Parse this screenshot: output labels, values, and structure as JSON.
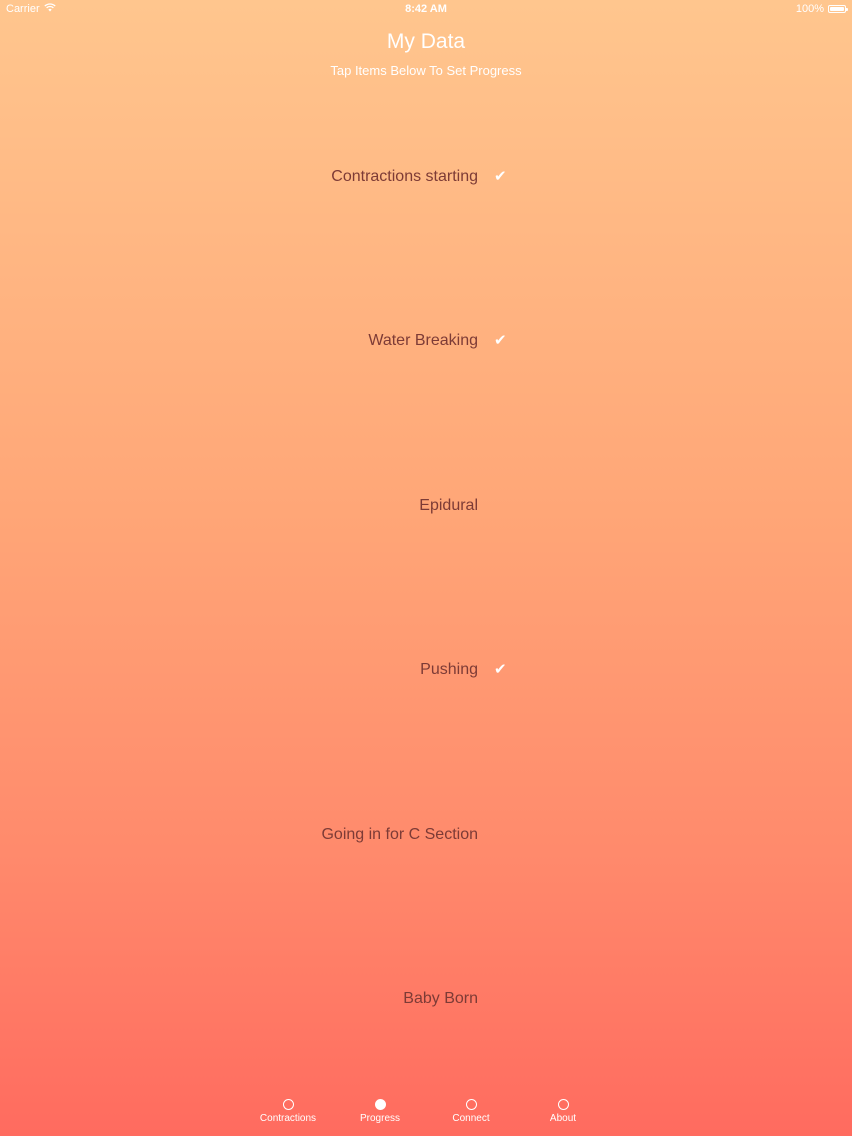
{
  "status_bar": {
    "carrier": "Carrier",
    "time": "8:42 AM",
    "battery": "100%",
    "icons": [
      "wifi-icon",
      "battery-icon"
    ]
  },
  "header": {
    "title": "My Data",
    "subtitle": "Tap Items Below To Set Progress"
  },
  "items": [
    {
      "label": "Contractions starting",
      "checked": true,
      "check": "✔"
    },
    {
      "label": "Water Breaking",
      "checked": true,
      "check": "✔"
    },
    {
      "label": "Epidural",
      "checked": false,
      "check": ""
    },
    {
      "label": "Pushing",
      "checked": true,
      "check": "✔"
    },
    {
      "label": "Going in for C Section",
      "checked": false,
      "check": ""
    },
    {
      "label": "Baby Born",
      "checked": false,
      "check": ""
    }
  ],
  "tabs": [
    {
      "label": "Contractions",
      "selected": false
    },
    {
      "label": "Progress",
      "selected": true
    },
    {
      "label": "Connect",
      "selected": false
    },
    {
      "label": "About",
      "selected": false
    }
  ],
  "colors": {
    "gradient_top": "#ffc68e",
    "gradient_bottom": "#ff6b5f",
    "item_text": "#7d3b36",
    "accent": "#ffffff"
  }
}
